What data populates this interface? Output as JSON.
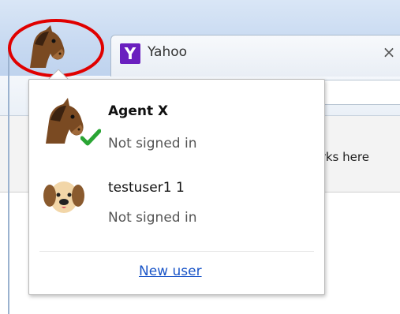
{
  "tab": {
    "title": "Yahoo",
    "favicon_letter": "Y",
    "close_glyph": "×"
  },
  "bookmarks_bar": {
    "hint_text": "harks here"
  },
  "profile_menu": {
    "users": [
      {
        "name": "Agent X",
        "status": "Not signed in",
        "avatar": "horse-avatar-icon",
        "active": true
      },
      {
        "name": "testuser1 1",
        "status": "Not signed in",
        "avatar": "dog-avatar-icon",
        "active": false
      }
    ],
    "new_user_label": "New user"
  },
  "colors": {
    "highlight_circle": "#e00000",
    "link": "#1a55c8",
    "checkmark": "#2aa534",
    "yahoo_purple": "#6a1fbf"
  }
}
